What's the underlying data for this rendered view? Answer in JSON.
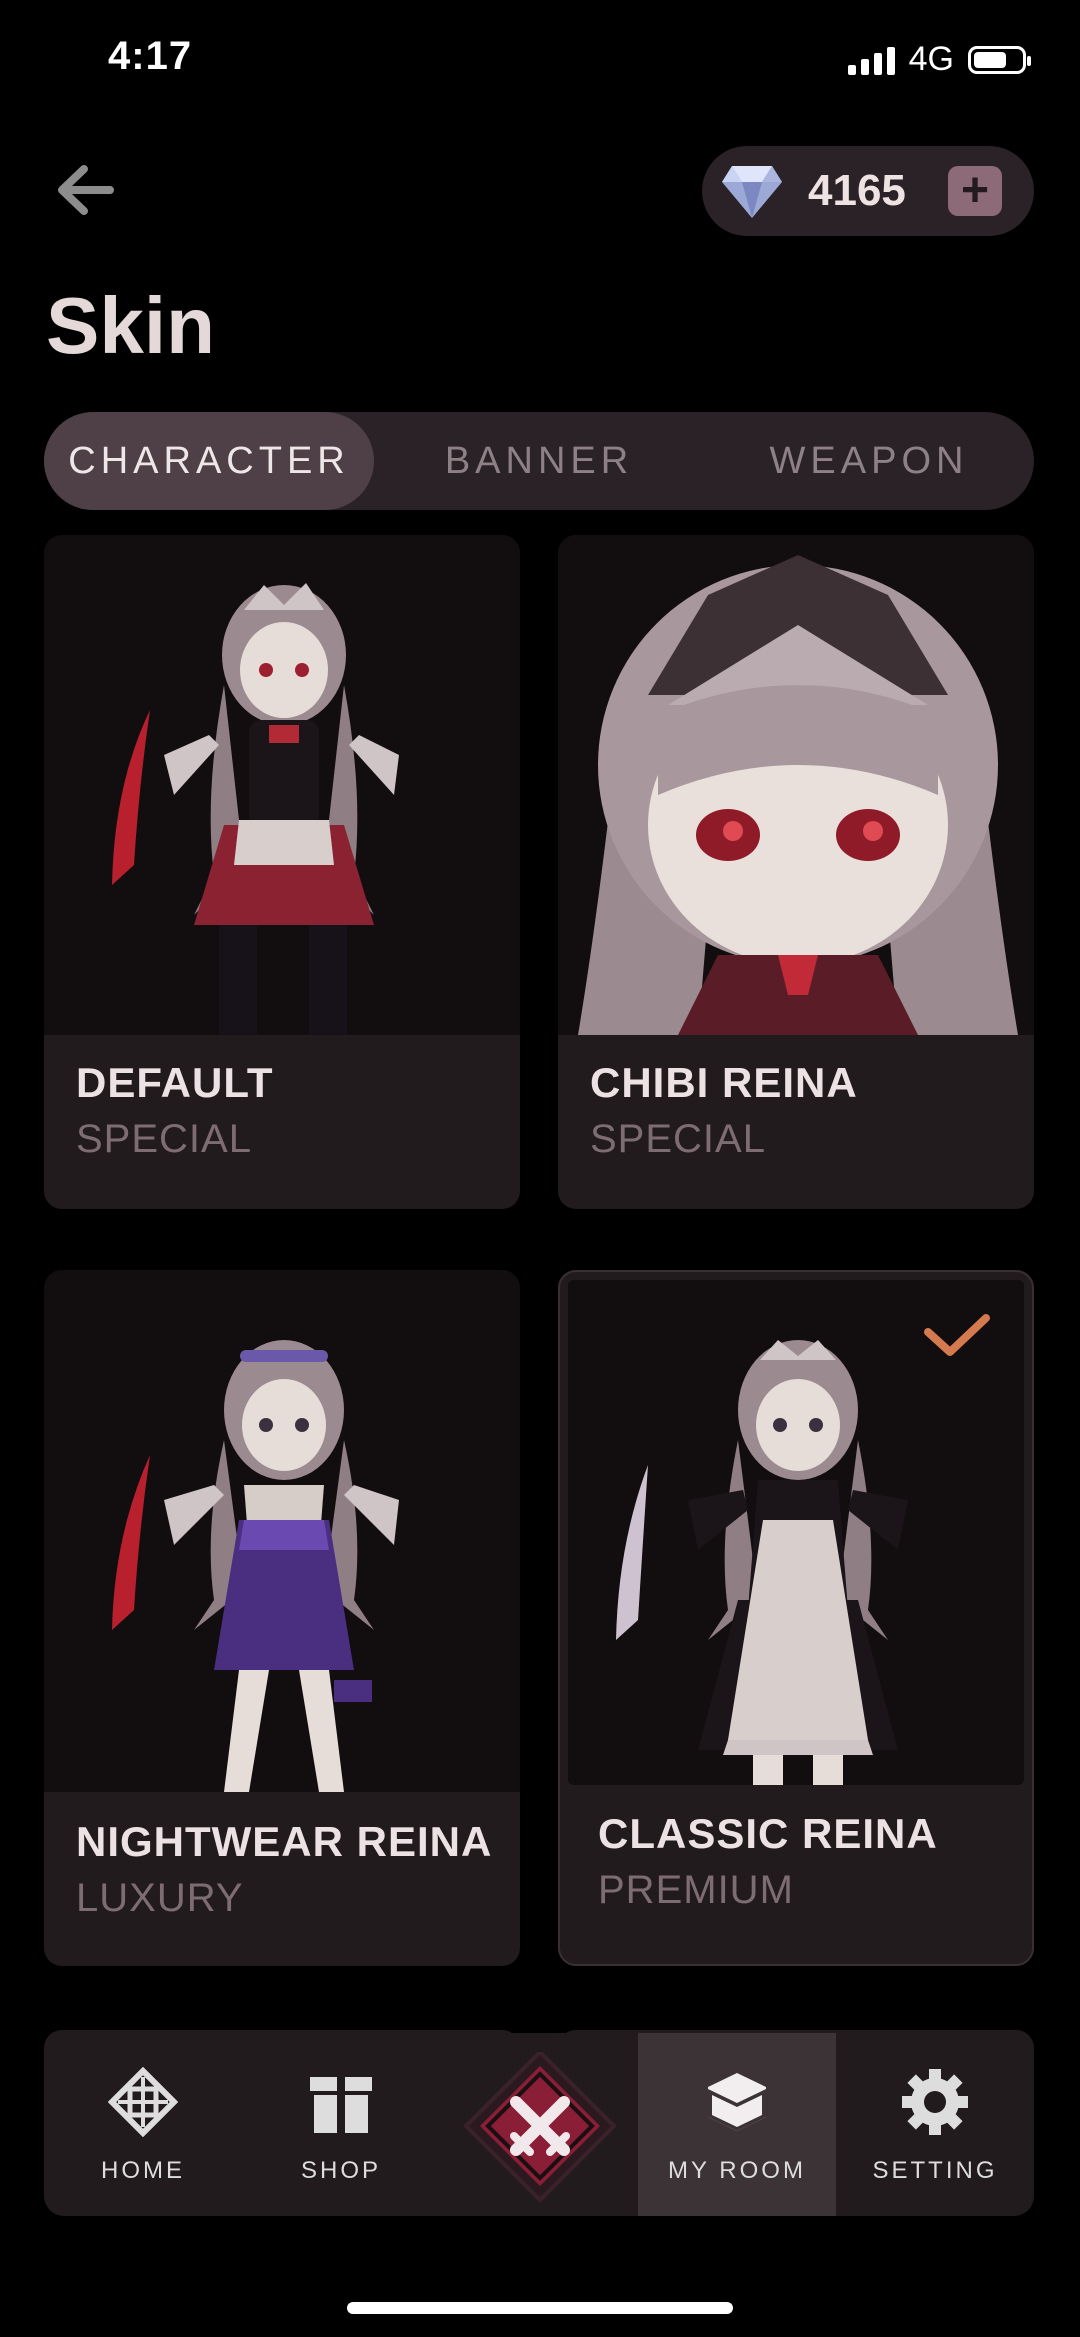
{
  "status_bar": {
    "time": "4:17",
    "network": "4G"
  },
  "header": {
    "gem_count": "4165",
    "plus_label": "+",
    "title": "Skin"
  },
  "tabs": [
    {
      "label": "CHARACTER",
      "active": true
    },
    {
      "label": "BANNER",
      "active": false
    },
    {
      "label": "WEAPON",
      "active": false
    }
  ],
  "skins": [
    {
      "name": "DEFAULT",
      "rarity": "SPECIAL",
      "selected": false
    },
    {
      "name": "CHIBI REINA",
      "rarity": "SPECIAL",
      "selected": false
    },
    {
      "name": "NIGHTWEAR REINA",
      "rarity": "LUXURY",
      "selected": false
    },
    {
      "name": "CLASSIC REINA",
      "rarity": "PREMIUM",
      "selected": true
    }
  ],
  "nav": [
    {
      "label": "HOME",
      "icon": "diamond-target-icon"
    },
    {
      "label": "SHOP",
      "icon": "gift-icon"
    },
    {
      "label": "",
      "icon": "crossed-swords-icon"
    },
    {
      "label": "MY ROOM",
      "icon": "cube-icon",
      "active": true
    },
    {
      "label": "SETTING",
      "icon": "gear-icon"
    }
  ],
  "colors": {
    "background": "#000000",
    "card": "#221b1e",
    "accent_check": "#d47a4e",
    "battle": "#8a1e36"
  }
}
